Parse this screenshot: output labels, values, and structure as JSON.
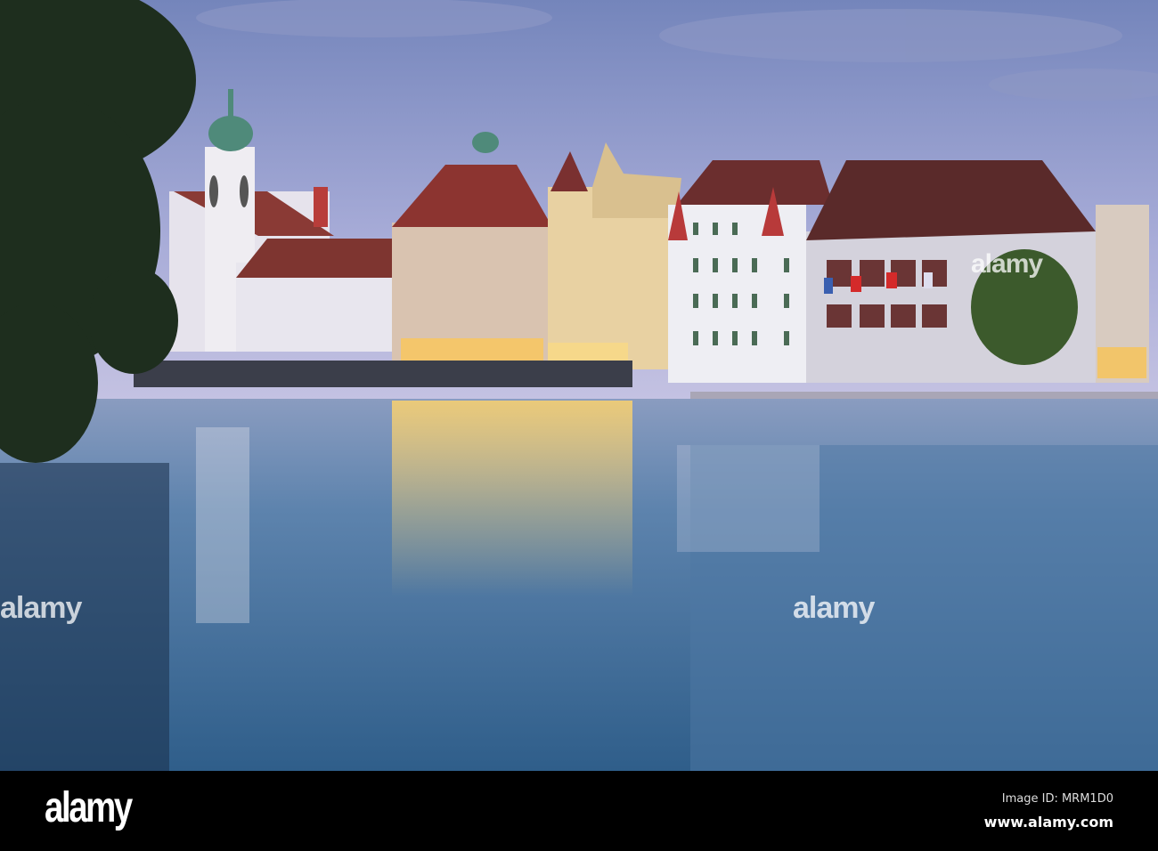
{
  "watermark": {
    "text": "alamy"
  },
  "footer": {
    "logo": "alamy",
    "image_id": "Image ID: MRM1D0",
    "website": "www.alamy.com"
  },
  "colors": {
    "sky_top": "#7e8fc4",
    "sky_bottom": "#b9bde0",
    "water": "#3f6f9a",
    "light": "#f2c56a"
  }
}
